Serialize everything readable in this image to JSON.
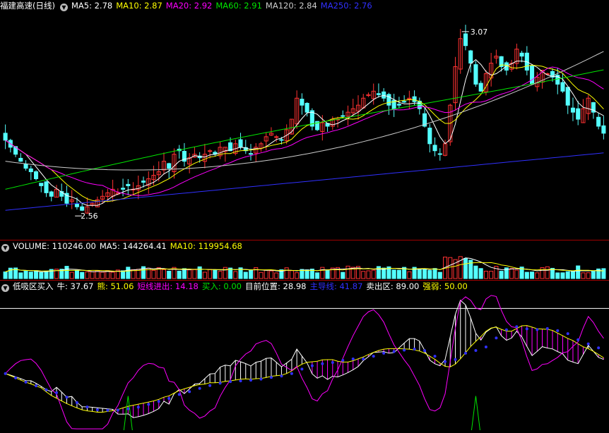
{
  "colors": {
    "bg": "#000000",
    "up": "#ff3232",
    "down": "#54ffff",
    "grid": "#8b0000",
    "ma5": "#ffffff",
    "ma10": "#ffff00",
    "ma20": "#ff00ff",
    "ma60": "#00e600",
    "ma120": "#cccccc",
    "ma250": "#3030ff"
  },
  "price_panel": {
    "title": "福建高速(日线)",
    "indicators": [
      {
        "label": "MA5: 2.78",
        "color": "#ffffff"
      },
      {
        "label": "MA10: 2.87",
        "color": "#ffff00"
      },
      {
        "label": "MA20: 2.92",
        "color": "#ff00ff"
      },
      {
        "label": "MA60: 2.91",
        "color": "#00e600"
      },
      {
        "label": "MA120: 2.84",
        "color": "#cccccc"
      },
      {
        "label": "MA250: 2.76",
        "color": "#3030ff"
      }
    ],
    "high_label": "3.07",
    "low_label": "2.56"
  },
  "volume_panel": {
    "indicators": [
      {
        "label": "VOLUME: 110246.00",
        "color": "#ffffff"
      },
      {
        "label": "MA5: 144264.41",
        "color": "#ffffff"
      },
      {
        "label": "MA10: 119954.68",
        "color": "#ffff00"
      }
    ]
  },
  "indicator_panel": {
    "indicators": [
      {
        "label": "低吸区买入",
        "color": "#ffffff"
      },
      {
        "label": "牛: 37.67",
        "color": "#ffffff"
      },
      {
        "label": "熊: 51.06",
        "color": "#ffff00"
      },
      {
        "label": "短线进出: 14.18",
        "color": "#ff00ff"
      },
      {
        "label": "买入: 0.00",
        "color": "#00e600"
      },
      {
        "label": "目前位置: 28.98",
        "color": "#ffffff"
      },
      {
        "label": "主导线: 41.87",
        "color": "#3030ff"
      },
      {
        "label": "卖出区: 89.00",
        "color": "#ffffff"
      },
      {
        "label": "强弱: 50.00",
        "color": "#ffff00"
      }
    ]
  },
  "chart_data": [
    {
      "type": "candlestick",
      "title": "福建高速(日线)",
      "ylim": [
        2.5,
        3.12
      ],
      "close": [
        2.76,
        2.74,
        2.72,
        2.7,
        2.68,
        2.67,
        2.65,
        2.63,
        2.61,
        2.6,
        2.62,
        2.6,
        2.58,
        2.59,
        2.57,
        2.56,
        2.57,
        2.58,
        2.59,
        2.6,
        2.61,
        2.62,
        2.61,
        2.62,
        2.63,
        2.62,
        2.63,
        2.64,
        2.65,
        2.66,
        2.67,
        2.7,
        2.68,
        2.72,
        2.73,
        2.7,
        2.71,
        2.72,
        2.71,
        2.72,
        2.73,
        2.72,
        2.74,
        2.74,
        2.73,
        2.75,
        2.74,
        2.73,
        2.72,
        2.74,
        2.75,
        2.77,
        2.78,
        2.77,
        2.76,
        2.79,
        2.82,
        2.88,
        2.86,
        2.84,
        2.8,
        2.79,
        2.81,
        2.8,
        2.82,
        2.82,
        2.83,
        2.84,
        2.85,
        2.86,
        2.88,
        2.89,
        2.9,
        2.89,
        2.88,
        2.86,
        2.85,
        2.86,
        2.87,
        2.88,
        2.87,
        2.85,
        2.8,
        2.75,
        2.73,
        2.72,
        2.75,
        2.86,
        2.97,
        3.05,
        3.03,
        2.98,
        2.92,
        2.9,
        2.95,
        2.98,
        3.0,
        2.97,
        2.96,
        2.98,
        3.02,
        3.0,
        2.96,
        2.92,
        2.94,
        2.96,
        2.95,
        2.94,
        2.92,
        2.9,
        2.86,
        2.84,
        2.82,
        2.85,
        2.88,
        2.84,
        2.8,
        2.78
      ],
      "low_label": 2.56,
      "high_label": 3.07
    },
    {
      "type": "bar",
      "series": [
        {
          "name": "VOLUME",
          "last": 110246.0
        },
        {
          "name": "MA5",
          "last": 144264.41
        },
        {
          "name": "MA10",
          "last": 119954.68
        }
      ]
    },
    {
      "type": "line",
      "ylim": [
        0,
        100
      ],
      "series": [
        {
          "name": "牛",
          "last": 37.67
        },
        {
          "name": "熊",
          "last": 51.06
        },
        {
          "name": "短线进出",
          "last": 14.18
        },
        {
          "name": "买入",
          "last": 0.0
        },
        {
          "name": "目前位置",
          "last": 28.98
        },
        {
          "name": "主导线",
          "last": 41.87
        },
        {
          "name": "卖出区",
          "last": 89.0
        },
        {
          "name": "强弱",
          "last": 50.0
        }
      ]
    }
  ]
}
